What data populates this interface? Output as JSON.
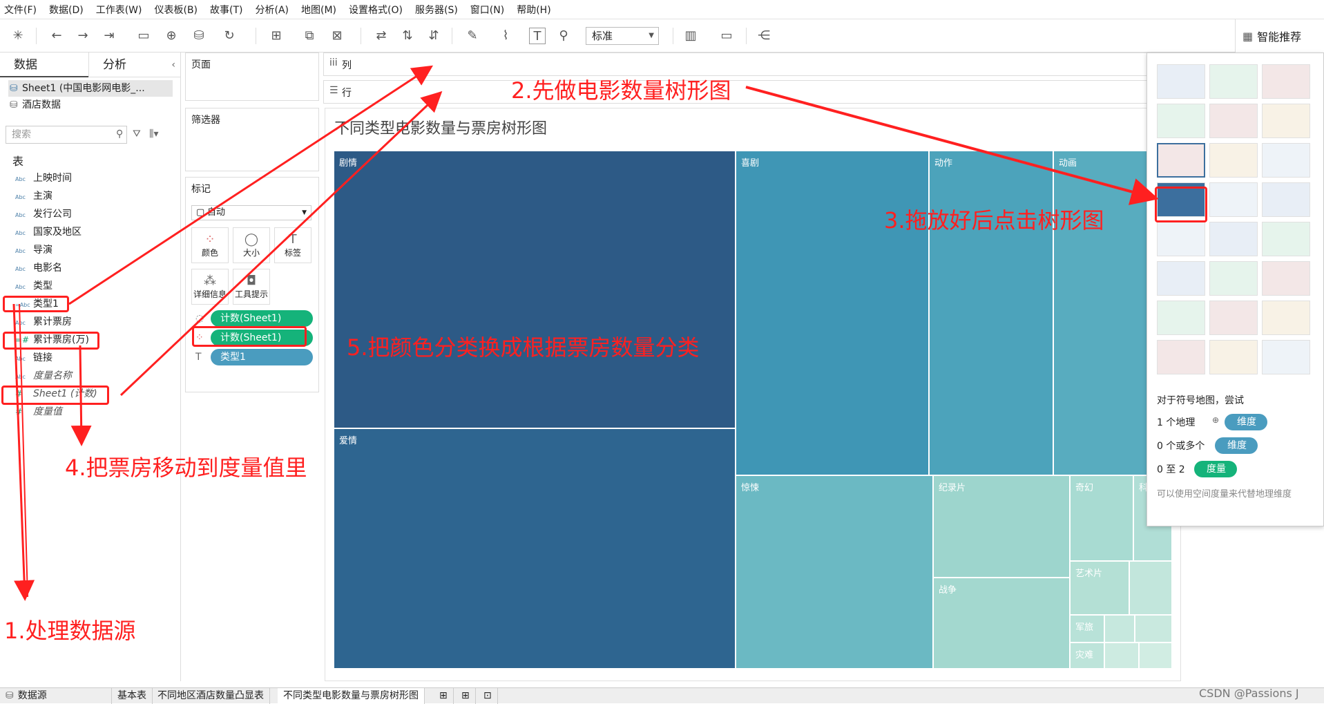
{
  "menu": [
    "文件(F)",
    "数据(D)",
    "工作表(W)",
    "仪表板(B)",
    "故事(T)",
    "分析(A)",
    "地图(M)",
    "设置格式(O)",
    "服务器(S)",
    "窗口(N)",
    "帮助(H)"
  ],
  "toolbar": {
    "fit_value": "标准",
    "showme_label": "智能推荐"
  },
  "datapane": {
    "tab_data": "数据",
    "tab_analysis": "分析",
    "sources": [
      "Sheet1 (中国电影网电影_...",
      "酒店数据"
    ],
    "search_placeholder": "搜索",
    "tables_header": "表",
    "fields": [
      {
        "type": "Abc",
        "name": "上映时间"
      },
      {
        "type": "Abc",
        "name": "主演"
      },
      {
        "type": "Abc",
        "name": "发行公司"
      },
      {
        "type": "Abc",
        "name": "国家及地区"
      },
      {
        "type": "Abc",
        "name": "导演"
      },
      {
        "type": "Abc",
        "name": "电影名"
      },
      {
        "type": "Abc",
        "name": "类型"
      },
      {
        "type": "=Abc",
        "name": "类型1"
      },
      {
        "type": "Abc",
        "name": "累计票房"
      },
      {
        "type": "=#",
        "name": "累计票房(万)"
      },
      {
        "type": "Abc",
        "name": "链接"
      },
      {
        "type": "Abc",
        "name": "度量名称"
      },
      {
        "type": "#",
        "name": "Sheet1 (计数)"
      },
      {
        "type": "#",
        "name": "度量值"
      }
    ]
  },
  "shelves": {
    "pages": "页面",
    "filters": "筛选器",
    "marks": "标记",
    "marks_type": "自动",
    "columns": "列",
    "rows": "行",
    "mark_buttons": [
      "颜色",
      "大小",
      "标签",
      "详细信息",
      "工具提示"
    ],
    "mark_pills": [
      "计数(Sheet1)",
      "计数(Sheet1)",
      "类型1"
    ]
  },
  "viz": {
    "title": "不同类型电影数量与票房树形图",
    "cells": [
      "剧情",
      "爱情",
      "喜剧",
      "动作",
      "动画",
      "惊悚",
      "纪录片",
      "奇幻",
      "科",
      "艺术片",
      "战争",
      "军旅",
      "灾难"
    ]
  },
  "showme": {
    "hint_title": "对于符号地图，尝试",
    "rows": [
      {
        "label": "1 个地理",
        "pill": "维度"
      },
      {
        "label": "0 个或多个",
        "pill": "维度"
      },
      {
        "label": "0 至 2",
        "pill": "度量"
      }
    ],
    "note": "可以使用空间度量来代替地理维度"
  },
  "bottom_tabs": [
    "数据源",
    "基本表",
    "不同地区酒店数量凸显表",
    "不同类型电影数量与票房树形图"
  ],
  "annotations": {
    "a1": "1.处理数据源",
    "a2": "2.先做电影数量树形图",
    "a3": "3.拖放好后点击树形图",
    "a4": "4.把票房移动到度量值里",
    "a5": "5.把颜色分类换成根据票房数量分类"
  },
  "watermark": "CSDN @Passions J",
  "colors": {
    "accent_red": "#ff2020",
    "pill_green": "#15b37a",
    "pill_blue": "#4a9cbf",
    "tree_dark": "#2d5a86"
  }
}
